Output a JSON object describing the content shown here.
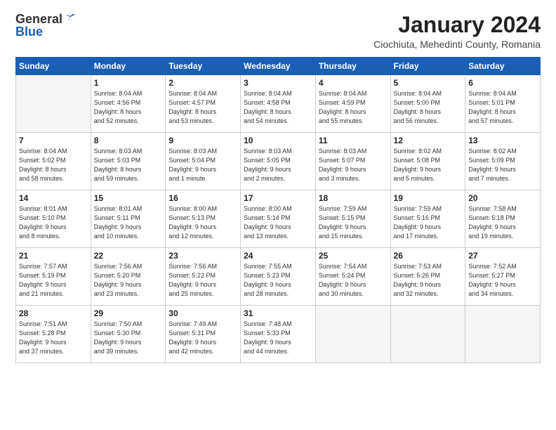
{
  "header": {
    "logo_general": "General",
    "logo_blue": "Blue",
    "title": "January 2024",
    "subtitle": "Ciochiuta, Mehedinti County, Romania"
  },
  "days_of_week": [
    "Sunday",
    "Monday",
    "Tuesday",
    "Wednesday",
    "Thursday",
    "Friday",
    "Saturday"
  ],
  "weeks": [
    [
      {
        "day": "",
        "info": ""
      },
      {
        "day": "1",
        "info": "Sunrise: 8:04 AM\nSunset: 4:56 PM\nDaylight: 8 hours\nand 52 minutes."
      },
      {
        "day": "2",
        "info": "Sunrise: 8:04 AM\nSunset: 4:57 PM\nDaylight: 8 hours\nand 53 minutes."
      },
      {
        "day": "3",
        "info": "Sunrise: 8:04 AM\nSunset: 4:58 PM\nDaylight: 8 hours\nand 54 minutes."
      },
      {
        "day": "4",
        "info": "Sunrise: 8:04 AM\nSunset: 4:59 PM\nDaylight: 8 hours\nand 55 minutes."
      },
      {
        "day": "5",
        "info": "Sunrise: 8:04 AM\nSunset: 5:00 PM\nDaylight: 8 hours\nand 56 minutes."
      },
      {
        "day": "6",
        "info": "Sunrise: 8:04 AM\nSunset: 5:01 PM\nDaylight: 8 hours\nand 57 minutes."
      }
    ],
    [
      {
        "day": "7",
        "info": "Sunrise: 8:04 AM\nSunset: 5:02 PM\nDaylight: 8 hours\nand 58 minutes."
      },
      {
        "day": "8",
        "info": "Sunrise: 8:03 AM\nSunset: 5:03 PM\nDaylight: 8 hours\nand 59 minutes."
      },
      {
        "day": "9",
        "info": "Sunrise: 8:03 AM\nSunset: 5:04 PM\nDaylight: 9 hours\nand 1 minute."
      },
      {
        "day": "10",
        "info": "Sunrise: 8:03 AM\nSunset: 5:05 PM\nDaylight: 9 hours\nand 2 minutes."
      },
      {
        "day": "11",
        "info": "Sunrise: 8:03 AM\nSunset: 5:07 PM\nDaylight: 9 hours\nand 3 minutes."
      },
      {
        "day": "12",
        "info": "Sunrise: 8:02 AM\nSunset: 5:08 PM\nDaylight: 9 hours\nand 5 minutes."
      },
      {
        "day": "13",
        "info": "Sunrise: 8:02 AM\nSunset: 5:09 PM\nDaylight: 9 hours\nand 7 minutes."
      }
    ],
    [
      {
        "day": "14",
        "info": "Sunrise: 8:01 AM\nSunset: 5:10 PM\nDaylight: 9 hours\nand 8 minutes."
      },
      {
        "day": "15",
        "info": "Sunrise: 8:01 AM\nSunset: 5:11 PM\nDaylight: 9 hours\nand 10 minutes."
      },
      {
        "day": "16",
        "info": "Sunrise: 8:00 AM\nSunset: 5:13 PM\nDaylight: 9 hours\nand 12 minutes."
      },
      {
        "day": "17",
        "info": "Sunrise: 8:00 AM\nSunset: 5:14 PM\nDaylight: 9 hours\nand 13 minutes."
      },
      {
        "day": "18",
        "info": "Sunrise: 7:59 AM\nSunset: 5:15 PM\nDaylight: 9 hours\nand 15 minutes."
      },
      {
        "day": "19",
        "info": "Sunrise: 7:59 AM\nSunset: 5:16 PM\nDaylight: 9 hours\nand 17 minutes."
      },
      {
        "day": "20",
        "info": "Sunrise: 7:58 AM\nSunset: 5:18 PM\nDaylight: 9 hours\nand 19 minutes."
      }
    ],
    [
      {
        "day": "21",
        "info": "Sunrise: 7:57 AM\nSunset: 5:19 PM\nDaylight: 9 hours\nand 21 minutes."
      },
      {
        "day": "22",
        "info": "Sunrise: 7:56 AM\nSunset: 5:20 PM\nDaylight: 9 hours\nand 23 minutes."
      },
      {
        "day": "23",
        "info": "Sunrise: 7:56 AM\nSunset: 5:22 PM\nDaylight: 9 hours\nand 25 minutes."
      },
      {
        "day": "24",
        "info": "Sunrise: 7:55 AM\nSunset: 5:23 PM\nDaylight: 9 hours\nand 28 minutes."
      },
      {
        "day": "25",
        "info": "Sunrise: 7:54 AM\nSunset: 5:24 PM\nDaylight: 9 hours\nand 30 minutes."
      },
      {
        "day": "26",
        "info": "Sunrise: 7:53 AM\nSunset: 5:26 PM\nDaylight: 9 hours\nand 32 minutes."
      },
      {
        "day": "27",
        "info": "Sunrise: 7:52 AM\nSunset: 5:27 PM\nDaylight: 9 hours\nand 34 minutes."
      }
    ],
    [
      {
        "day": "28",
        "info": "Sunrise: 7:51 AM\nSunset: 5:28 PM\nDaylight: 9 hours\nand 37 minutes."
      },
      {
        "day": "29",
        "info": "Sunrise: 7:50 AM\nSunset: 5:30 PM\nDaylight: 9 hours\nand 39 minutes."
      },
      {
        "day": "30",
        "info": "Sunrise: 7:49 AM\nSunset: 5:31 PM\nDaylight: 9 hours\nand 42 minutes."
      },
      {
        "day": "31",
        "info": "Sunrise: 7:48 AM\nSunset: 5:33 PM\nDaylight: 9 hours\nand 44 minutes."
      },
      {
        "day": "",
        "info": ""
      },
      {
        "day": "",
        "info": ""
      },
      {
        "day": "",
        "info": ""
      }
    ]
  ]
}
